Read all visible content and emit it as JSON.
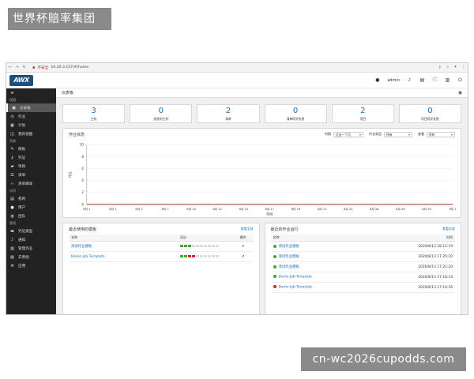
{
  "watermark_top": "世界杯赔率集团",
  "watermark_bottom": "cn-wc2026cupodds.com",
  "browser": {
    "insecure_label": "不安全",
    "url": "10.20.3.157/#/home"
  },
  "header": {
    "logo": "AWX",
    "user": "admin"
  },
  "sidebar": {
    "view_section": "视图",
    "view_items": [
      {
        "label": "仪表板",
        "icon": "dashboard-icon",
        "active": true
      },
      {
        "label": "作业",
        "icon": "jobs-icon"
      },
      {
        "label": "计划",
        "icon": "calendar-icon"
      },
      {
        "label": "我的视图",
        "icon": "my-view-icon"
      }
    ],
    "resource_section": "资源",
    "resource_items": [
      {
        "label": "模板",
        "icon": "pencil-icon"
      },
      {
        "label": "凭证",
        "icon": "key-icon"
      },
      {
        "label": "项目",
        "icon": "folder-icon"
      },
      {
        "label": "清单",
        "icon": "inventory-icon"
      },
      {
        "label": "清单脚本",
        "icon": "code-icon"
      }
    ],
    "access_section": "访问",
    "access_items": [
      {
        "label": "机构",
        "icon": "building-icon"
      },
      {
        "label": "用户",
        "icon": "user-icon"
      },
      {
        "label": "团队",
        "icon": "team-icon"
      }
    ],
    "admin_section": "管理",
    "admin_items": [
      {
        "label": "凭证类型",
        "icon": "credential-type-icon"
      },
      {
        "label": "通知",
        "icon": "bell-icon"
      },
      {
        "label": "管理作业",
        "icon": "management-jobs-icon"
      },
      {
        "label": "实例组",
        "icon": "instance-groups-icon"
      },
      {
        "label": "应用",
        "icon": "apps-icon"
      }
    ]
  },
  "page": {
    "title": "仪表板"
  },
  "cards": [
    {
      "value": "3",
      "label": "主机"
    },
    {
      "value": "0",
      "label": "失败的主机"
    },
    {
      "value": "2",
      "label": "清单"
    },
    {
      "value": "0",
      "label": "清单同步失败"
    },
    {
      "value": "2",
      "label": "项目"
    },
    {
      "value": "0",
      "label": "项目同步失败"
    }
  ],
  "job_status": {
    "title": "作业状态",
    "period_label": "时期",
    "period_value": "过去一个月",
    "type_label": "作业类型",
    "type_value": "所有",
    "view_label": "查看",
    "view_value": "所有"
  },
  "chart_data": {
    "type": "line",
    "xlabel": "时间",
    "ylabel": "作业",
    "ylim": [
      0,
      10
    ],
    "yticks": [
      0,
      2,
      4,
      6,
      8,
      10
    ],
    "x_tick_labels": [
      "8月 1",
      "8月 3",
      "8月 5",
      "8月 7",
      "8月 10",
      "8月 12",
      "8月 14",
      "8月 17",
      "8月 19",
      "8月 21",
      "8月 24",
      "8月 26",
      "8月 28",
      "8月 30",
      "9月 1"
    ],
    "x": [
      "8/1",
      "8/2",
      "8/3",
      "8/4",
      "8/5",
      "8/6",
      "8/7",
      "8/8",
      "8/9",
      "8/10",
      "8/11",
      "8/12",
      "8/13",
      "8/14",
      "8/15",
      "8/16",
      "8/17",
      "8/18",
      "8/19",
      "8/20",
      "8/21",
      "8/22",
      "8/23",
      "8/24",
      "8/25",
      "8/26",
      "8/27",
      "8/28",
      "8/29",
      "8/30",
      "8/31",
      "9/1"
    ],
    "series": [
      {
        "color": "#3aa935",
        "values": [
          0,
          0,
          0,
          0,
          0,
          0,
          0,
          0,
          0,
          0,
          0,
          0,
          0,
          0,
          0,
          0,
          0,
          0,
          0,
          0,
          0,
          0,
          0,
          0,
          0,
          0,
          0,
          0,
          0,
          0,
          0,
          0
        ]
      },
      {
        "color": "#c0392b",
        "values": [
          0,
          0,
          0,
          0,
          0,
          0,
          0,
          0,
          0,
          0,
          0,
          0,
          0,
          0,
          0,
          0,
          0,
          0,
          0,
          0,
          0,
          0,
          0,
          0,
          0,
          0,
          0,
          0,
          0,
          0,
          0,
          0
        ]
      }
    ]
  },
  "recent_templates": {
    "title": "最近使用的模板",
    "link": "查看全部",
    "columns": [
      "名称",
      "活动",
      "操作"
    ],
    "rows": [
      {
        "name": "测试作业模板",
        "activity": [
          "g",
          "g",
          "g",
          "n",
          "n",
          "n",
          "n",
          "n",
          "n",
          "n"
        ]
      },
      {
        "name": "Demo Job Template",
        "activity": [
          "g",
          "g",
          "r",
          "r",
          "n",
          "n",
          "n",
          "n",
          "n",
          "n"
        ]
      }
    ]
  },
  "recent_jobs": {
    "title": "最近的作业运行",
    "link": "查看全部",
    "columns": [
      "名称",
      "时间"
    ],
    "rows": [
      {
        "status": "g",
        "name": "测试作业模板",
        "time": "2020/8/13 18:12:19"
      },
      {
        "status": "g",
        "name": "测试作业模板",
        "time": "2020/8/13 17:25:10"
      },
      {
        "status": "g",
        "name": "测试作业模板",
        "time": "2020/8/13 17:21:20"
      },
      {
        "status": "g",
        "name": "Demo Job Template",
        "time": "2020/8/13 17:18:14"
      },
      {
        "status": "r",
        "name": "Demo Job Template",
        "time": "2020/8/13 17:14:35"
      }
    ]
  }
}
